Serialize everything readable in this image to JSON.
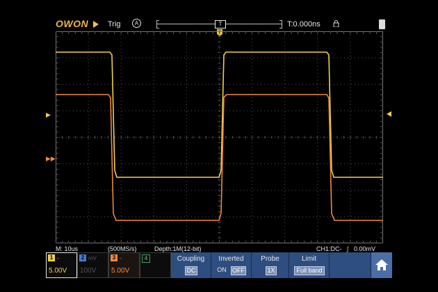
{
  "header": {
    "logo": "OWON",
    "trig_label": "Trig",
    "trig_mode": "A",
    "timeline_marker": "T",
    "time_offset": "T:0.000ns"
  },
  "status": {
    "timebase": "M: 10us",
    "sample_rate": "(500MS/s)",
    "depth": "Depth:1M(12-bit)",
    "trigger": "CH1:DC-",
    "trigger_level": "0.00mV"
  },
  "channels": [
    {
      "num": "1",
      "coupling": "-",
      "scale": "5.00V",
      "color": "#f2d04d",
      "active": true
    },
    {
      "num": "2",
      "coupling": "mV",
      "scale": "100V",
      "color": "#3f7fd4",
      "active": false
    },
    {
      "num": "3",
      "coupling": "-",
      "scale": "5.00V",
      "color": "#f2893d",
      "active": true
    },
    {
      "num": "4",
      "coupling": "",
      "scale": "",
      "color": "#3ca35c",
      "active": false
    }
  ],
  "menu": {
    "coupling": {
      "title": "Coupling",
      "value": "DC"
    },
    "inverted": {
      "title": "Inverted",
      "on": "ON",
      "off": "OFF"
    },
    "probe": {
      "title": "Probe",
      "value": "1X"
    },
    "limit": {
      "title": "Limit",
      "value": "Full band"
    }
  },
  "colors": {
    "ch1": "#f2d04d",
    "ch3": "#f2893d",
    "menu_bg": "#2e4d80",
    "grid": "#555555"
  },
  "icons": {
    "run": "play-triangle-icon",
    "lock": "lock-icon",
    "battery": "battery-icon",
    "home": "home-icon"
  }
}
